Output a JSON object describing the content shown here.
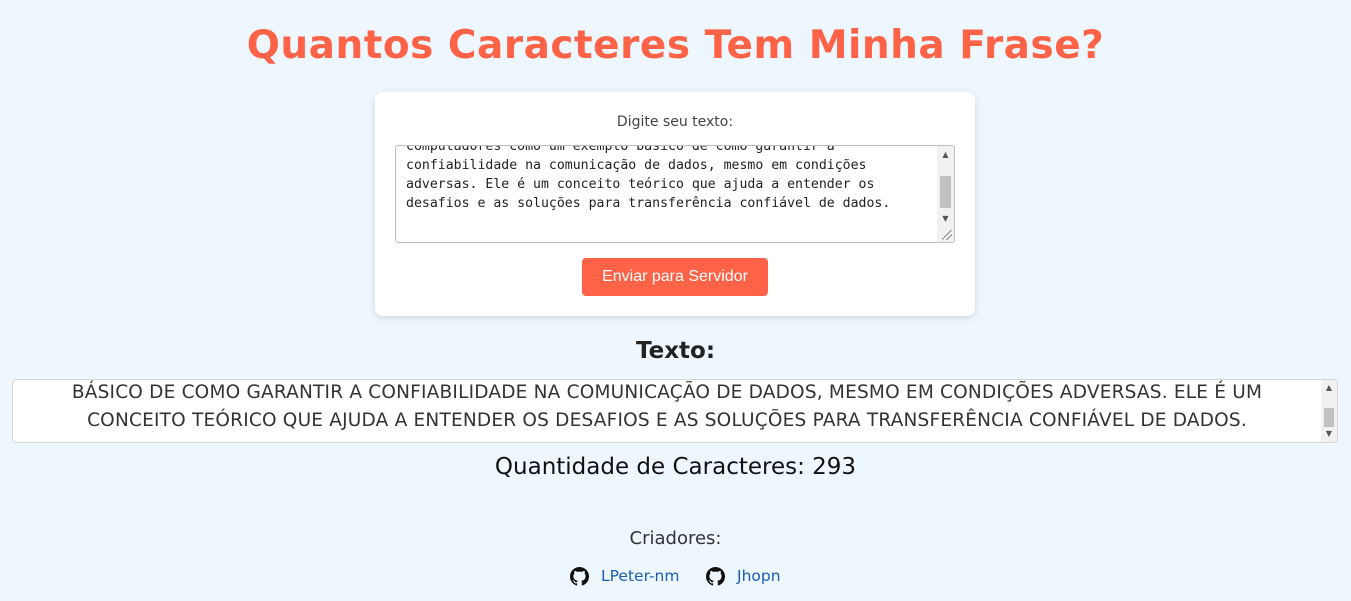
{
  "header": {
    "title": "Quantos Caracteres Tem Minha Frase?"
  },
  "form": {
    "label": "Digite seu texto:",
    "textarea_value": "computadores como um exemplo básico de como garantir a confiabilidade na comunicação de dados, mesmo em condições adversas. Ele é um conceito teórico que ajuda a entender os desafios e as soluções para transferência confiável de dados.",
    "submit_label": "Enviar para Servidor"
  },
  "result": {
    "heading": "Texto:",
    "text": "BÁSICO DE COMO GARANTIR A CONFIABILIDADE NA COMUNICAÇÃO DE DADOS, MESMO EM CONDIÇÕES ADVERSAS. ELE É UM CONCEITO TEÓRICO QUE AJUDA A ENTENDER OS DESAFIOS E AS SOLUÇÕES PARA TRANSFERÊNCIA CONFIÁVEL DE DADOS.",
    "count_label": "Quantidade de Caracteres: 293"
  },
  "footer": {
    "creators_label": "Criadores:",
    "creators": [
      {
        "name": "LPeter-nm",
        "icon": "github-icon"
      },
      {
        "name": "Jhopn",
        "icon": "github-icon"
      }
    ]
  },
  "colors": {
    "accent": "#ff6347",
    "background": "#eef6fe",
    "link": "#1a5fb4"
  }
}
